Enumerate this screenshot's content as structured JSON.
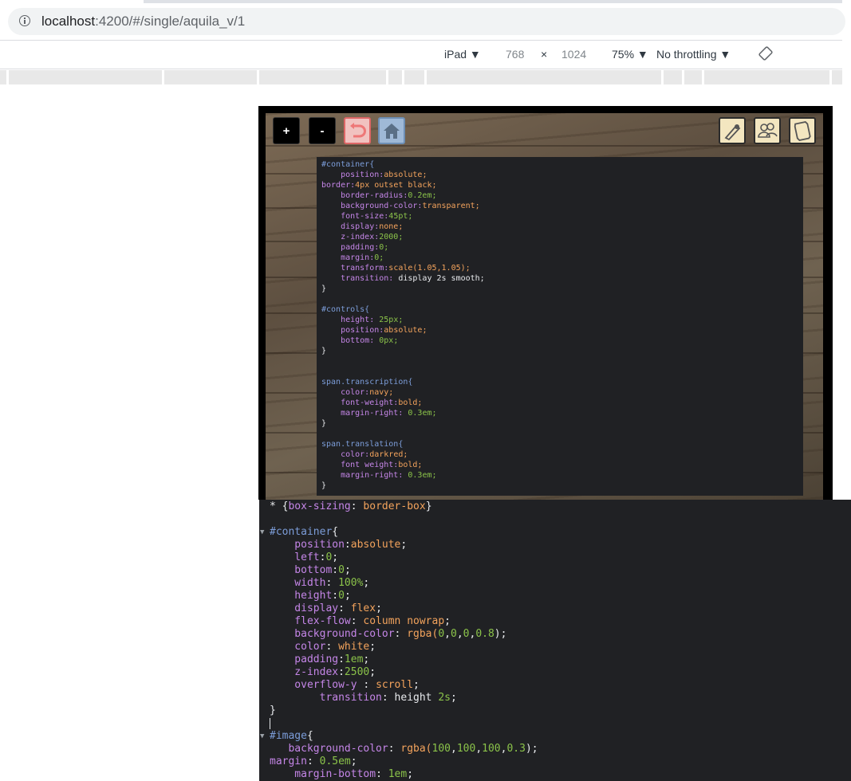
{
  "browser": {
    "url_host": "localhost",
    "url_path": ":4200/#/single/aquila_v/1"
  },
  "device_toolbar": {
    "device": "iPad ▼",
    "width": "768",
    "times": "×",
    "height": "1024",
    "zoom": "75% ▼",
    "throttling": "No throttling ▼"
  },
  "viewer_controls": {
    "zoom_in": "+",
    "zoom_out": "-"
  },
  "inner_editor_lines": [
    [
      [
        "#container{",
        "sel"
      ]
    ],
    [
      [
        "    position:",
        "prop"
      ],
      [
        "absolute;",
        "val"
      ]
    ],
    [
      [
        "border:",
        "prop"
      ],
      [
        "4px outset black;",
        "val"
      ]
    ],
    [
      [
        "    border-radius:",
        "prop"
      ],
      [
        "0.2em;",
        "num"
      ]
    ],
    [
      [
        "    background-color:",
        "prop"
      ],
      [
        "transparent;",
        "val"
      ]
    ],
    [
      [
        "    font-size:",
        "prop"
      ],
      [
        "45pt;",
        "num"
      ]
    ],
    [
      [
        "    display:",
        "prop"
      ],
      [
        "none;",
        "val"
      ]
    ],
    [
      [
        "    z-index:",
        "prop"
      ],
      [
        "2000;",
        "num"
      ]
    ],
    [
      [
        "    padding:",
        "prop"
      ],
      [
        "0;",
        "num"
      ]
    ],
    [
      [
        "    margin:",
        "prop"
      ],
      [
        "0;",
        "num"
      ]
    ],
    [
      [
        "    transform:",
        "prop"
      ],
      [
        "scale(1.05,1.05);",
        "val"
      ]
    ],
    [
      [
        "    transition:",
        "prop"
      ],
      [
        " display 2s smooth;",
        "pun"
      ]
    ],
    [
      [
        "}",
        "pun"
      ]
    ],
    [
      [
        "",
        "pun"
      ]
    ],
    [
      [
        "#controls{",
        "sel"
      ]
    ],
    [
      [
        "    height:",
        "prop"
      ],
      [
        " 25px;",
        "num"
      ]
    ],
    [
      [
        "    position:",
        "prop"
      ],
      [
        "absolute;",
        "val"
      ]
    ],
    [
      [
        "    bottom:",
        "prop"
      ],
      [
        " 0px;",
        "num"
      ]
    ],
    [
      [
        "}",
        "pun"
      ]
    ],
    [
      [
        "",
        "pun"
      ]
    ],
    [
      [
        "",
        "pun"
      ]
    ],
    [
      [
        "span.transcription{",
        "sel"
      ]
    ],
    [
      [
        "    color:",
        "prop"
      ],
      [
        "navy;",
        "val"
      ]
    ],
    [
      [
        "    font-weight:",
        "prop"
      ],
      [
        "bold;",
        "val"
      ]
    ],
    [
      [
        "    margin-right:",
        "prop"
      ],
      [
        " 0.3em;",
        "num"
      ]
    ],
    [
      [
        "}",
        "pun"
      ]
    ],
    [
      [
        "",
        "pun"
      ]
    ],
    [
      [
        "span.translation{",
        "sel"
      ]
    ],
    [
      [
        "    color:",
        "prop"
      ],
      [
        "darkred;",
        "val"
      ]
    ],
    [
      [
        "    font weight:",
        "prop"
      ],
      [
        "bold;",
        "val"
      ]
    ],
    [
      [
        "    margin-right:",
        "prop"
      ],
      [
        " 0.3em;",
        "num"
      ]
    ],
    [
      [
        "}",
        "pun"
      ]
    ]
  ],
  "devtools_lines": [
    {
      "tri": "",
      "parts": [
        [
          "* {",
          "pun"
        ],
        [
          "box-sizing",
          "prop"
        ],
        [
          ": ",
          "pun"
        ],
        [
          "border-box",
          "val"
        ],
        [
          "}",
          "pun"
        ]
      ]
    },
    {
      "tri": "",
      "parts": []
    },
    {
      "tri": "▼",
      "parts": [
        [
          "#container",
          "sel"
        ],
        [
          "{",
          "pun"
        ]
      ]
    },
    {
      "tri": "",
      "parts": [
        [
          "    position",
          "prop"
        ],
        [
          ":",
          "pun"
        ],
        [
          "absolute",
          "val"
        ],
        [
          ";",
          "pun"
        ]
      ]
    },
    {
      "tri": "",
      "parts": [
        [
          "    left",
          "prop"
        ],
        [
          ":",
          "pun"
        ],
        [
          "0",
          "num"
        ],
        [
          ";",
          "pun"
        ]
      ]
    },
    {
      "tri": "",
      "parts": [
        [
          "    bottom",
          "prop"
        ],
        [
          ":",
          "pun"
        ],
        [
          "0",
          "num"
        ],
        [
          ";",
          "pun"
        ]
      ]
    },
    {
      "tri": "",
      "parts": [
        [
          "    width",
          "prop"
        ],
        [
          ": ",
          "pun"
        ],
        [
          "100%",
          "num"
        ],
        [
          ";",
          "pun"
        ]
      ]
    },
    {
      "tri": "",
      "parts": [
        [
          "    height",
          "prop"
        ],
        [
          ":",
          "pun"
        ],
        [
          "0",
          "num"
        ],
        [
          ";",
          "pun"
        ]
      ]
    },
    {
      "tri": "",
      "parts": [
        [
          "    display",
          "prop"
        ],
        [
          ": ",
          "pun"
        ],
        [
          "flex",
          "val"
        ],
        [
          ";",
          "pun"
        ]
      ]
    },
    {
      "tri": "",
      "parts": [
        [
          "    flex-flow",
          "prop"
        ],
        [
          ": ",
          "pun"
        ],
        [
          "column nowrap",
          "val"
        ],
        [
          ";",
          "pun"
        ]
      ]
    },
    {
      "tri": "",
      "parts": [
        [
          "    background-color",
          "prop"
        ],
        [
          ": ",
          "pun"
        ],
        [
          "rgba(",
          "val"
        ],
        [
          "0",
          "num"
        ],
        [
          ",",
          "pun"
        ],
        [
          "0",
          "num"
        ],
        [
          ",",
          "pun"
        ],
        [
          "0",
          "num"
        ],
        [
          ",",
          "pun"
        ],
        [
          "0.8",
          "num"
        ],
        [
          ");",
          "pun"
        ]
      ]
    },
    {
      "tri": "",
      "parts": [
        [
          "    color",
          "prop"
        ],
        [
          ": ",
          "pun"
        ],
        [
          "white",
          "val"
        ],
        [
          ";",
          "pun"
        ]
      ]
    },
    {
      "tri": "",
      "parts": [
        [
          "    padding",
          "prop"
        ],
        [
          ":",
          "pun"
        ],
        [
          "1em",
          "num"
        ],
        [
          ";",
          "pun"
        ]
      ]
    },
    {
      "tri": "",
      "parts": [
        [
          "    z-index",
          "prop"
        ],
        [
          ":",
          "pun"
        ],
        [
          "2500",
          "num"
        ],
        [
          ";",
          "pun"
        ]
      ]
    },
    {
      "tri": "",
      "parts": [
        [
          "    overflow-y",
          "prop"
        ],
        [
          " : ",
          "pun"
        ],
        [
          "scroll",
          "val"
        ],
        [
          ";",
          "pun"
        ]
      ]
    },
    {
      "tri": "",
      "parts": [
        [
          "        transition",
          "prop"
        ],
        [
          ": ",
          "pun"
        ],
        [
          "height ",
          "pun"
        ],
        [
          "2s",
          "num"
        ],
        [
          ";",
          "pun"
        ]
      ]
    },
    {
      "tri": "",
      "parts": [
        [
          "}",
          "pun"
        ]
      ]
    },
    {
      "tri": "",
      "parts": [],
      "cursor": true
    },
    {
      "tri": "▼",
      "parts": [
        [
          "#image",
          "sel"
        ],
        [
          "{",
          "pun"
        ]
      ]
    },
    {
      "tri": "",
      "parts": [
        [
          "   background-color",
          "prop"
        ],
        [
          ": ",
          "pun"
        ],
        [
          "rgba(",
          "val"
        ],
        [
          "100",
          "num"
        ],
        [
          ",",
          "pun"
        ],
        [
          "100",
          "num"
        ],
        [
          ",",
          "pun"
        ],
        [
          "100",
          "num"
        ],
        [
          ",",
          "pun"
        ],
        [
          "0.3",
          "num"
        ],
        [
          ");",
          "pun"
        ]
      ]
    },
    {
      "tri": "",
      "parts": [
        [
          "margin",
          "prop"
        ],
        [
          ": ",
          "pun"
        ],
        [
          "0.5em",
          "num"
        ],
        [
          ";",
          "pun"
        ]
      ]
    },
    {
      "tri": "",
      "parts": [
        [
          "    margin-bottom",
          "prop"
        ],
        [
          ": ",
          "pun"
        ],
        [
          "1em",
          "num"
        ],
        [
          ";",
          "pun"
        ]
      ]
    }
  ]
}
